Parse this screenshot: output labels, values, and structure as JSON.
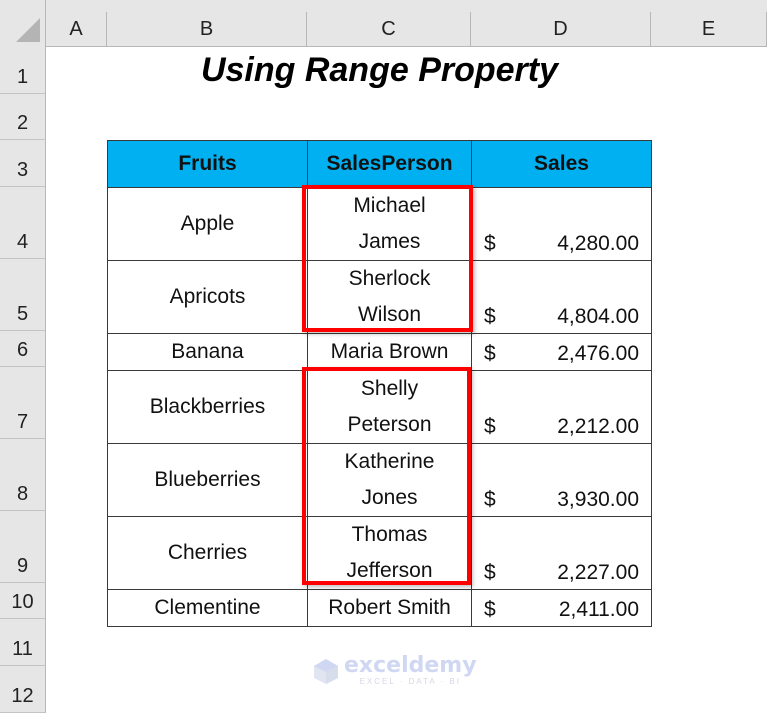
{
  "sheet": {
    "columns": [
      "A",
      "B",
      "C",
      "D",
      "E"
    ],
    "rows": [
      "1",
      "2",
      "3",
      "4",
      "5",
      "6",
      "7",
      "8",
      "9",
      "10",
      "11",
      "12"
    ]
  },
  "title": "Using Range Property",
  "table": {
    "headers": [
      "Fruits",
      "SalesPerson",
      "Sales"
    ],
    "header_color": "#00B0F0",
    "currency_symbol": "$",
    "rows": [
      {
        "fruit": "Apple",
        "person": [
          "Michael",
          "James"
        ],
        "sales": "4,280.00"
      },
      {
        "fruit": "Apricots",
        "person": [
          "Sherlock",
          "Wilson"
        ],
        "sales": "4,804.00"
      },
      {
        "fruit": "Banana",
        "person": [
          "Maria Brown"
        ],
        "sales": "2,476.00"
      },
      {
        "fruit": "Blackberries",
        "person": [
          "Shelly",
          "Peterson"
        ],
        "sales": "2,212.00"
      },
      {
        "fruit": "Blueberries",
        "person": [
          "Katherine",
          "Jones"
        ],
        "sales": "3,930.00"
      },
      {
        "fruit": "Cherries",
        "person": [
          "Thomas",
          "Jefferson"
        ],
        "sales": "2,227.00"
      },
      {
        "fruit": "Clementine",
        "person": [
          "Robert Smith"
        ],
        "sales": "2,411.00"
      }
    ]
  },
  "highlight_color": "#FF0000",
  "watermark": {
    "brand": "exceldemy",
    "tagline": "EXCEL · DATA · BI"
  }
}
